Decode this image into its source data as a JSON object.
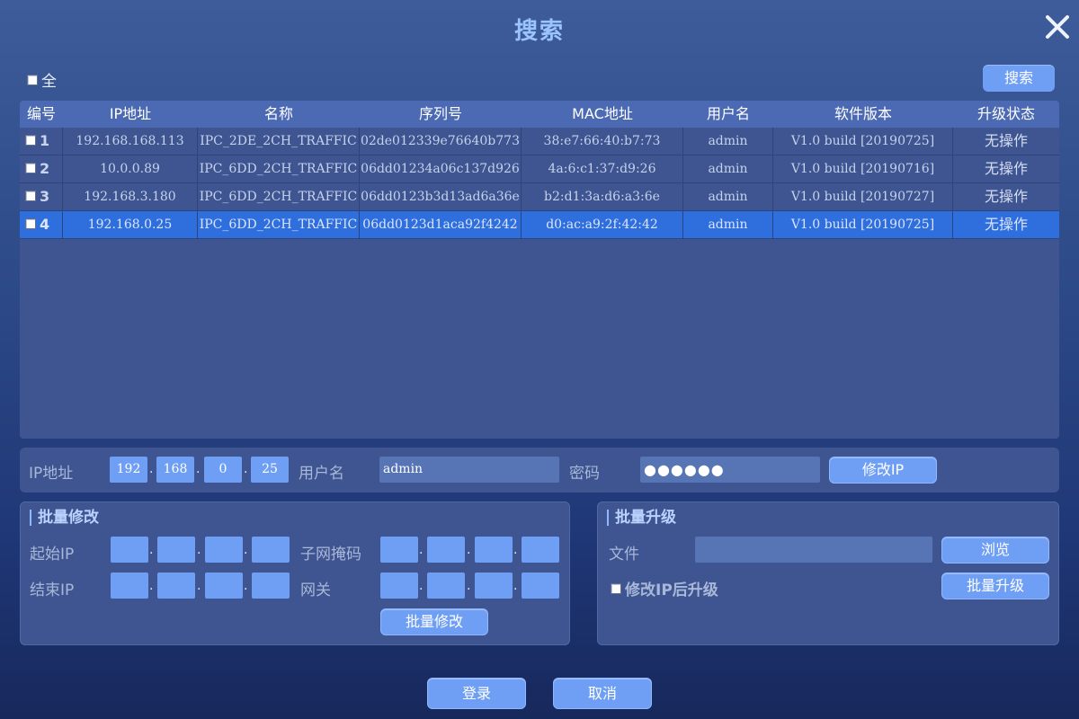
{
  "dialog": {
    "title": "搜索"
  },
  "toolbar": {
    "select_all_label": "全",
    "search_button": "搜索"
  },
  "table": {
    "columns": [
      "编号",
      "IP地址",
      "名称",
      "序列号",
      "MAC地址",
      "用户名",
      "软件版本",
      "升级状态"
    ],
    "rows": [
      {
        "num": "1",
        "ip": "192.168.168.113",
        "name": "IPC_2DE_2CH_TRAFFIC",
        "serial": "02de012339e76640b773",
        "mac": "38:e7:66:40:b7:73",
        "user": "admin",
        "version": "V1.0 build [20190725]",
        "status": "无操作"
      },
      {
        "num": "2",
        "ip": "10.0.0.89",
        "name": "IPC_6DD_2CH_TRAFFIC",
        "serial": "06dd01234a06c137d926",
        "mac": "4a:6:c1:37:d9:26",
        "user": "admin",
        "version": "V1.0 build [20190716]",
        "status": "无操作"
      },
      {
        "num": "3",
        "ip": "192.168.3.180",
        "name": "IPC_6DD_2CH_TRAFFIC",
        "serial": "06dd0123b3d13ad6a36e",
        "mac": "b2:d1:3a:d6:a3:6e",
        "user": "admin",
        "version": "V1.0 build [20190727]",
        "status": "无操作"
      },
      {
        "num": "4",
        "ip": "192.168.0.25",
        "name": "IPC_6DD_2CH_TRAFFIC",
        "serial": "06dd0123d1aca92f4242",
        "mac": "d0:ac:a9:2f:42:42",
        "user": "admin",
        "version": "V1.0 build [20190725]",
        "status": "无操作"
      }
    ]
  },
  "ip_edit": {
    "ip_label": "IP地址",
    "ip_octets": [
      "192",
      "168",
      "0",
      "25"
    ],
    "user_label": "用户名",
    "user_value": "admin",
    "password_label": "密码",
    "password_mask": "●●●●●●",
    "modify_button": "修改IP"
  },
  "batch_modify": {
    "title": "批量修改",
    "start_ip_label": "起始IP",
    "end_ip_label": "结束IP",
    "subnet_label": "子网掩码",
    "gateway_label": "网关",
    "button": "批量修改"
  },
  "batch_upgrade": {
    "title": "批量升级",
    "file_label": "文件",
    "browse_button": "浏览",
    "after_modify_label": "修改IP后升级",
    "button": "批量升级"
  },
  "footer": {
    "login_button": "登录",
    "cancel_button": "取消"
  },
  "colors": {
    "accent_button": "#6f9ff5",
    "selected_row": "#2f6fdd",
    "title": "#9bc4ff"
  },
  "icons": {
    "close": "close-icon",
    "checkbox": "checkbox-icon"
  }
}
